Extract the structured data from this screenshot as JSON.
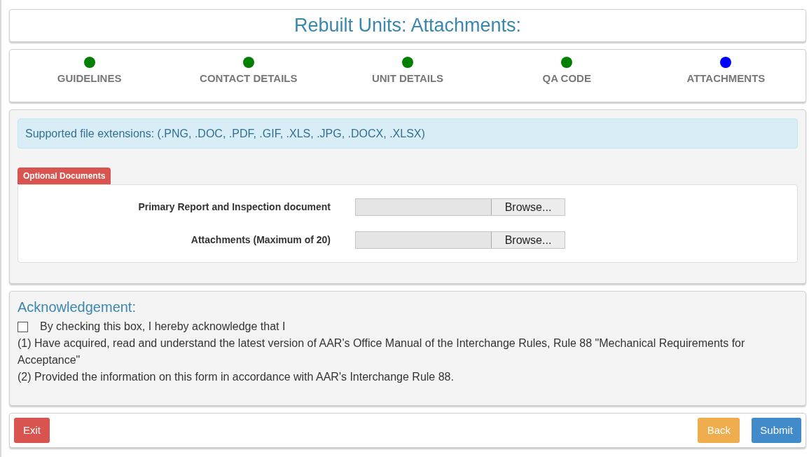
{
  "title": "Rebuilt Units: Attachments:",
  "steps": [
    {
      "label": "GUIDELINES",
      "color": "#008000"
    },
    {
      "label": "CONTACT DETAILS",
      "color": "#008000"
    },
    {
      "label": "UNIT DETAILS",
      "color": "#008000"
    },
    {
      "label": "QA CODE",
      "color": "#008000"
    },
    {
      "label": "ATTACHMENTS",
      "color": "#0000ff"
    }
  ],
  "info": "Supported file extensions: (.PNG, .DOC, .PDF, .GIF, .XLS, .JPG, .DOCX, .XLSX)",
  "section_badge": "Optional Documents",
  "uploads": [
    {
      "label": "Primary Report and Inspection document",
      "button": "Browse..."
    },
    {
      "label": "Attachments (Maximum of 20)",
      "button": "Browse..."
    }
  ],
  "acknowledgement": {
    "heading": "Acknowledgement:",
    "checkbox_label": "By checking this box, I hereby acknowledge that I",
    "checked": false,
    "lines": [
      "(1) Have acquired, read and understand the latest version of AAR's Office Manual of the Interchange Rules, Rule 88 \"Mechanical Requirements for Acceptance\"",
      "(2) Provided the information on this form in accordance with AAR's Interchange Rule 88."
    ]
  },
  "buttons": {
    "exit": "Exit",
    "back": "Back",
    "submit": "Submit"
  }
}
